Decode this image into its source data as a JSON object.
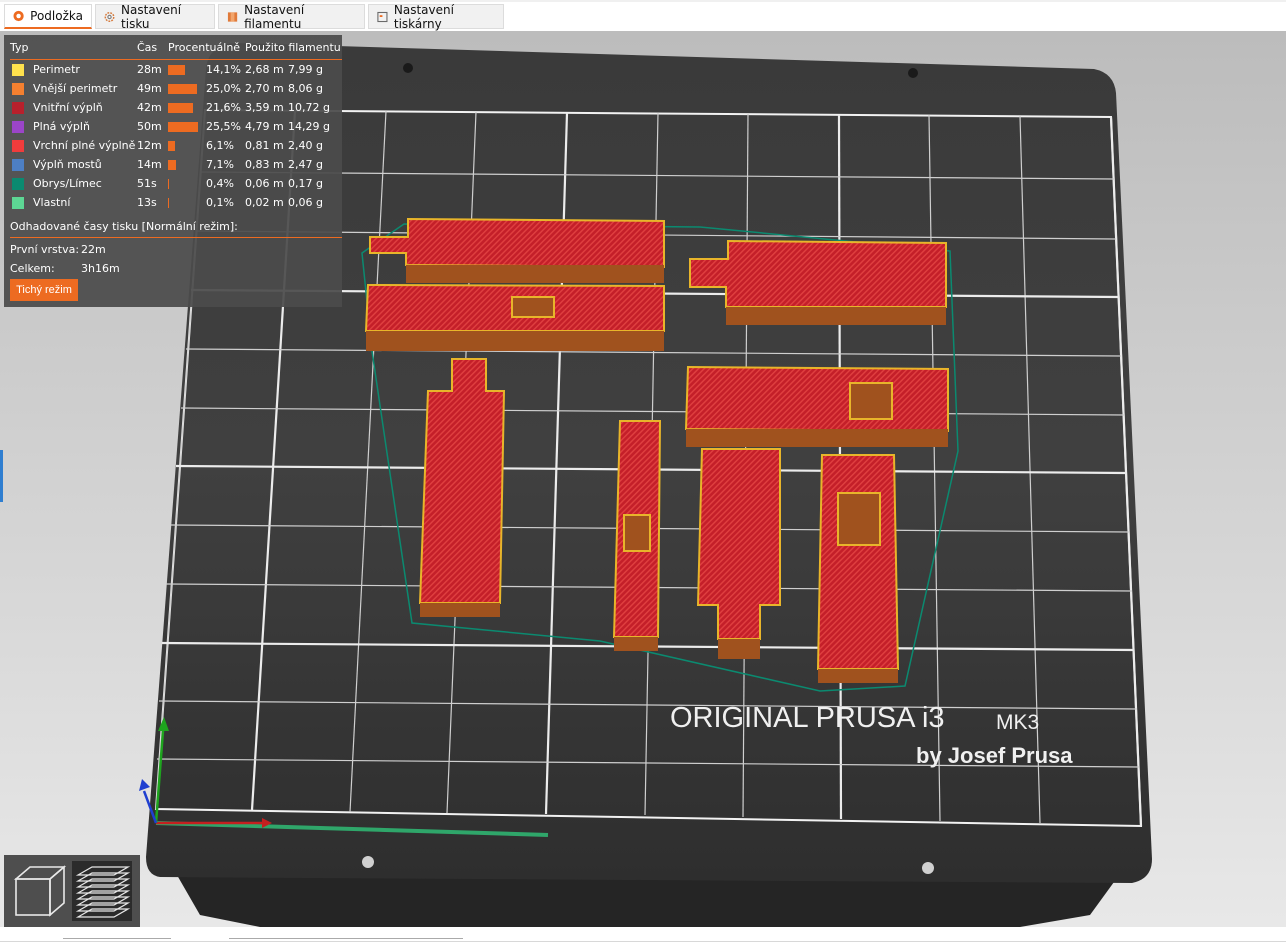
{
  "tabs": [
    {
      "label": "Podložka",
      "icon": "plate-icon",
      "active": true
    },
    {
      "label": "Nastavení tisku",
      "icon": "gear-icon",
      "active": false
    },
    {
      "label": "Nastavení filamentu",
      "icon": "filament-spool-icon",
      "active": false
    },
    {
      "label": "Nastavení tiskárny",
      "icon": "printer-icon",
      "active": false
    }
  ],
  "legend": {
    "headers": {
      "type": "Typ",
      "time": "Čas",
      "percent": "Procentuálně",
      "filament": "Použito filamentu"
    },
    "rows": [
      {
        "name": "Perimetr",
        "color": "#ffe14d",
        "time": "28m",
        "percent": "14,1%",
        "length": "2,68 m",
        "weight": "7,99 g",
        "fraction": 0.141
      },
      {
        "name": "Vnější perimetr",
        "color": "#f58030",
        "time": "49m",
        "percent": "25,0%",
        "length": "2,70 m",
        "weight": "8,06 g",
        "fraction": 0.25
      },
      {
        "name": "Vnitřní výplň",
        "color": "#b8202c",
        "time": "42m",
        "percent": "21,6%",
        "length": "3,59 m",
        "weight": "10,72 g",
        "fraction": 0.216
      },
      {
        "name": "Plná výplň",
        "color": "#9b45c8",
        "time": "50m",
        "percent": "25,5%",
        "length": "4,79 m",
        "weight": "14,29 g",
        "fraction": 0.255
      },
      {
        "name": "Vrchní plné výplně",
        "color": "#f03c3c",
        "time": "12m",
        "percent": "6,1%",
        "length": "0,81 m",
        "weight": "2,40 g",
        "fraction": 0.061
      },
      {
        "name": "Výplň mostů",
        "color": "#4d7fc4",
        "time": "14m",
        "percent": "7,1%",
        "length": "0,83 m",
        "weight": "2,47 g",
        "fraction": 0.071
      },
      {
        "name": "Obrys/Límec",
        "color": "#0b8a70",
        "time": "51s",
        "percent": "0,4%",
        "length": "0,06 m",
        "weight": "0,17 g",
        "fraction": 0.004
      },
      {
        "name": "Vlastní",
        "color": "#5dd694",
        "time": "13s",
        "percent": "0,1%",
        "length": "0,02 m",
        "weight": "0,06 g",
        "fraction": 0.001
      }
    ],
    "estimate_title": "Odhadované časy tisku [Normální režim]:",
    "first_layer_label": "První vrstva:",
    "first_layer_value": "22m",
    "total_label": "Celkem:",
    "total_value": "3h16m",
    "quiet_mode_button": "Tichý režim"
  },
  "bed": {
    "brand_line1": "ORIGINAL PRUSA i3",
    "brand_mk": "MK3",
    "brand_line2": "by Josef Prusa"
  },
  "view_buttons": [
    {
      "name": "3d-view-icon",
      "active": false
    },
    {
      "name": "layers-view-icon",
      "active": true
    }
  ],
  "colors": {
    "accent": "#ed6b21",
    "part_fill": "#c8202a",
    "part_edge": "#e8b52a",
    "skirt": "#0b8a70"
  }
}
